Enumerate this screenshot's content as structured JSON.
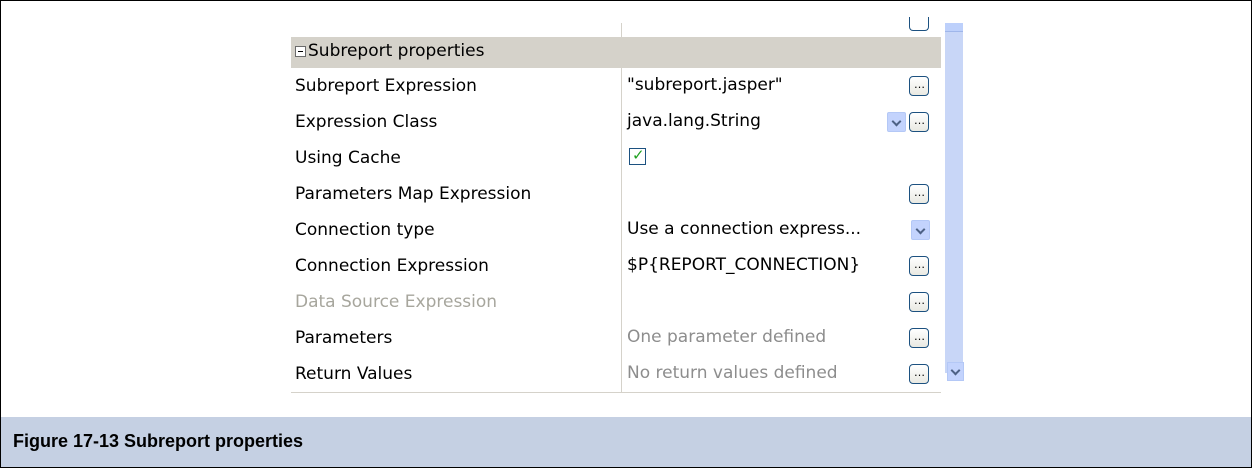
{
  "caption": "Figure 17-13  Subreport properties",
  "section": {
    "title": "Subreport properties"
  },
  "rows": [
    {
      "label": "Subreport Expression",
      "value": "\"subreport.jasper\"",
      "disabled": false
    },
    {
      "label": "Expression Class",
      "value": "java.lang.String",
      "disabled": false
    },
    {
      "label": "Using Cache",
      "value": "",
      "checked": true,
      "disabled": false
    },
    {
      "label": "Parameters Map Expression",
      "value": "",
      "disabled": false
    },
    {
      "label": "Connection type",
      "value": "Use a connection express...",
      "disabled": false
    },
    {
      "label": "Connection Expression",
      "value": "$P{REPORT_CONNECTION}",
      "disabled": false
    },
    {
      "label": "Data Source Expression",
      "value": "",
      "disabled": true
    },
    {
      "label": "Parameters",
      "value": "One parameter defined",
      "disabled": false
    },
    {
      "label": "Return Values",
      "value": "No return values defined",
      "disabled": false
    }
  ],
  "icons": {
    "expand_toggle": "minus-box-icon",
    "ellipsis": "ellipsis-button-icon",
    "dropdown": "chevron-down-icon",
    "checkbox": "checked-checkbox-icon"
  },
  "colors": {
    "caption_bg": "#c5d0e3",
    "section_bg": "#d5d2ca",
    "scrollbar": "#c8d6f7",
    "check": "#21a121"
  }
}
